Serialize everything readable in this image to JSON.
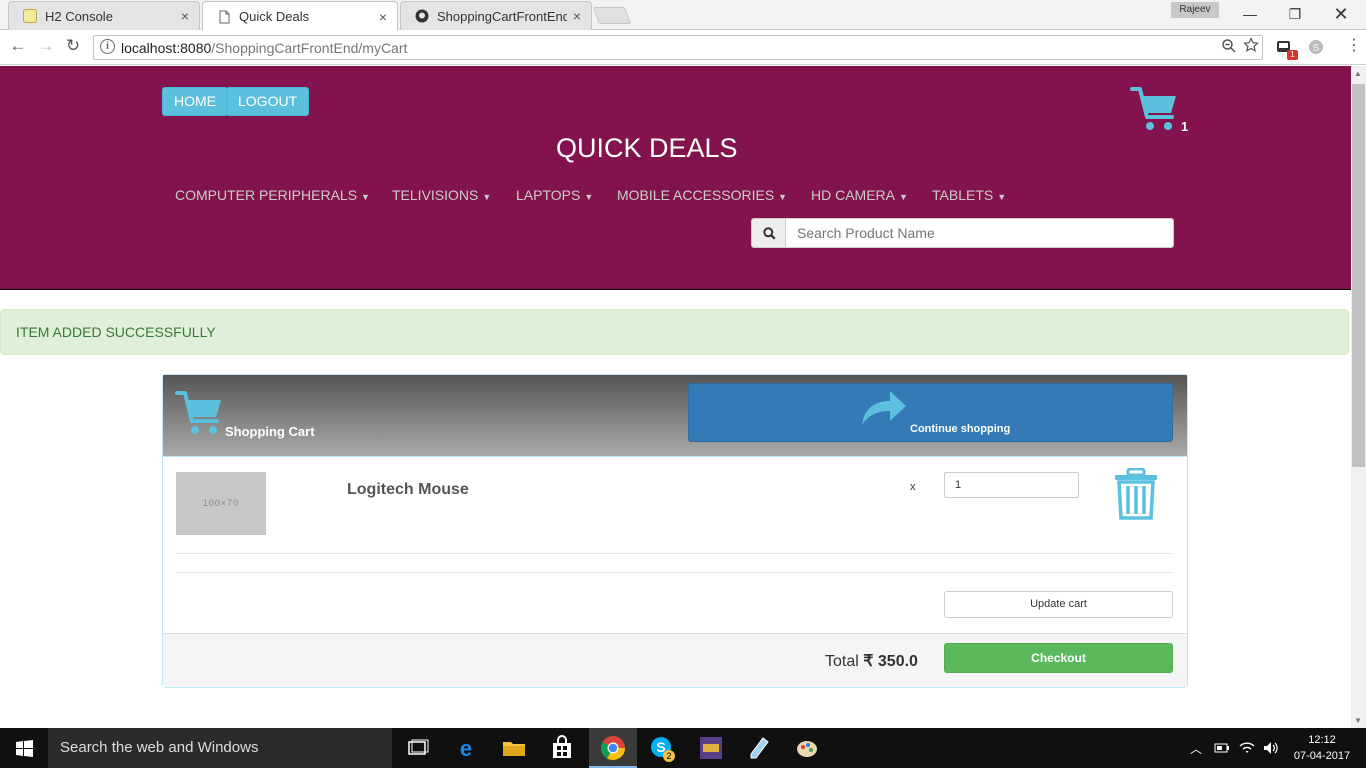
{
  "browser": {
    "tabs": [
      {
        "title": "H2 Console",
        "close": "×"
      },
      {
        "title": "Quick Deals",
        "close": "×"
      },
      {
        "title": "ShoppingCartFrontEndM",
        "close": "×"
      }
    ],
    "profile_name": "Rajeev",
    "url_host": "localhost:8080",
    "url_path": "/ShoppingCartFrontEnd/myCart",
    "extension_badge": "1"
  },
  "header": {
    "home_label": "HOME",
    "logout_label": "LOGOUT",
    "brand": "QUICK DEALS",
    "cart_count": "1",
    "nav": [
      "COMPUTER PERIPHERALS",
      "TELIVISIONS",
      "LAPTOPS",
      "MOBILE ACCESSORIES",
      "HD CAMERA",
      "TABLETS"
    ],
    "search_placeholder": "Search Product Name"
  },
  "alert": {
    "text": "ITEM ADDED SUCCESSFULLY"
  },
  "cart": {
    "title": "Shopping Cart",
    "continue_label": "Continue shopping",
    "items": [
      {
        "thumb_text": "100×70",
        "name": "Logitech Mouse",
        "multiplier": "x",
        "quantity": "1"
      }
    ],
    "update_label": "Update cart",
    "total_label": "Total",
    "currency": "₹",
    "total_value": "350.0",
    "checkout_label": "Checkout"
  },
  "taskbar": {
    "search_text": "Search the web and Windows",
    "time": "12:12",
    "date": "07-04-2017",
    "skype_badge": "2"
  },
  "colors": {
    "header_bg": "#82134c",
    "info_blue": "#5bc0de",
    "primary": "#337ab7",
    "success": "#5cb85c",
    "alert_bg": "#dff0d8"
  }
}
